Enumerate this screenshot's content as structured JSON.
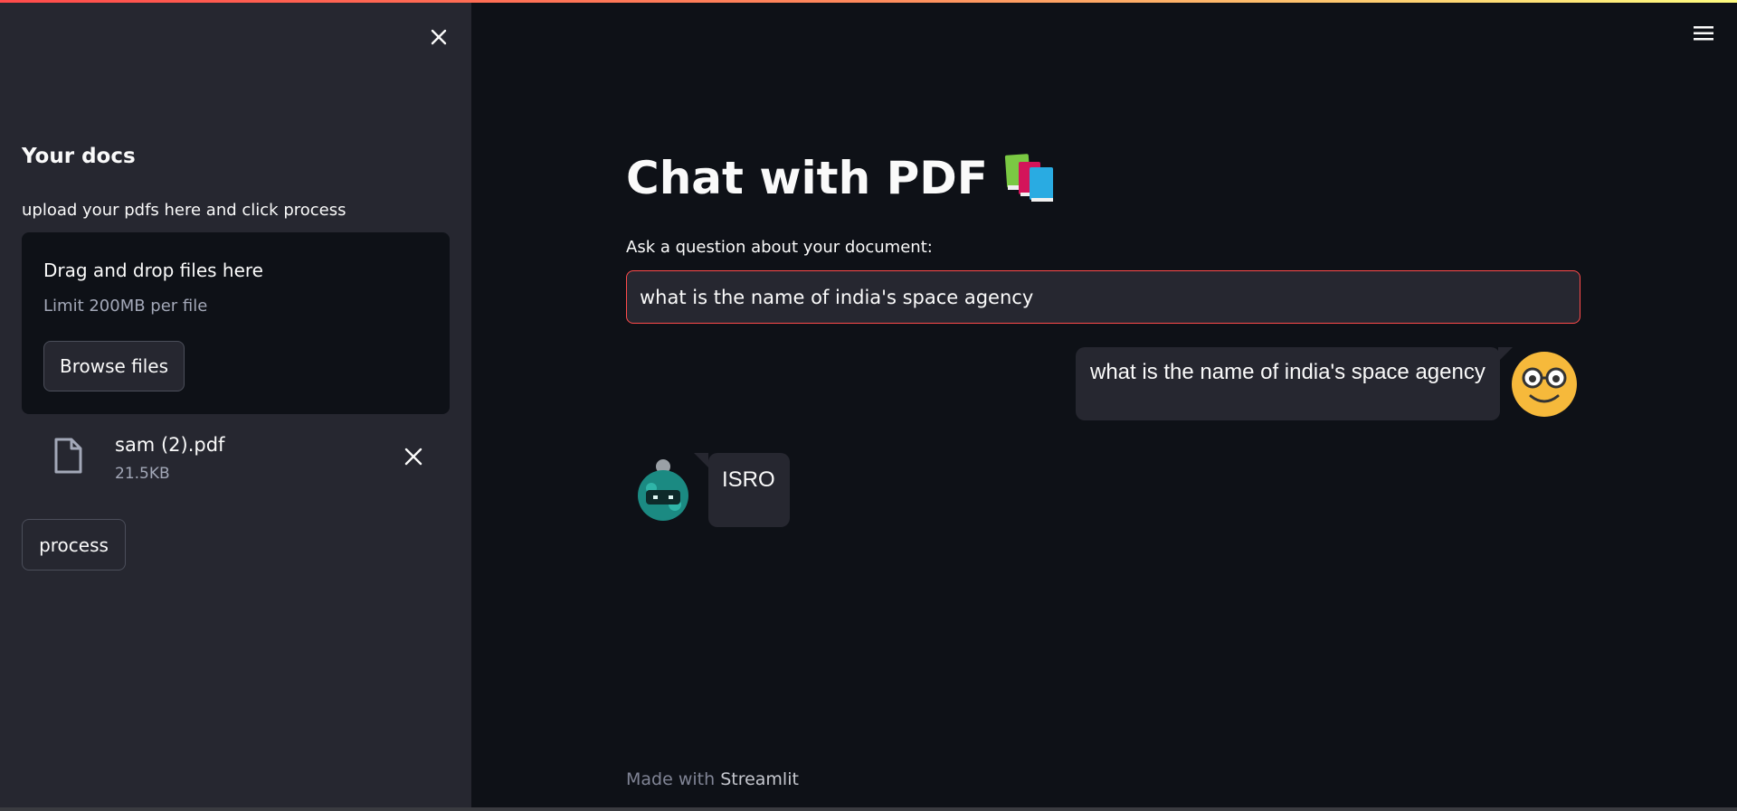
{
  "sidebar": {
    "title": "Your docs",
    "caption": "upload your pdfs here and click process",
    "uploader": {
      "drop_label": "Drag and drop files here",
      "limit": "Limit 200MB per file",
      "browse_label": "Browse files"
    },
    "file": {
      "name": "sam (2).pdf",
      "size": "21.5KB"
    },
    "process_label": "process"
  },
  "main": {
    "title": "Chat with PDF",
    "title_icon": "books-emoji-icon",
    "input_label": "Ask a question about your document:",
    "input_value": "what is the name of india's space agency",
    "messages": [
      {
        "role": "user",
        "text": "what is the name of india's space agency",
        "avatar": "nerd-face-icon"
      },
      {
        "role": "bot",
        "text": "ISRO",
        "avatar": "robot-icon"
      }
    ],
    "footer_prefix": "Made with",
    "footer_brand": "Streamlit"
  },
  "colors": {
    "background": "#0e1117",
    "sidebar": "#262730",
    "accent": "#ff4b4b",
    "text": "#fafafa",
    "muted": "#a3a8b8"
  }
}
